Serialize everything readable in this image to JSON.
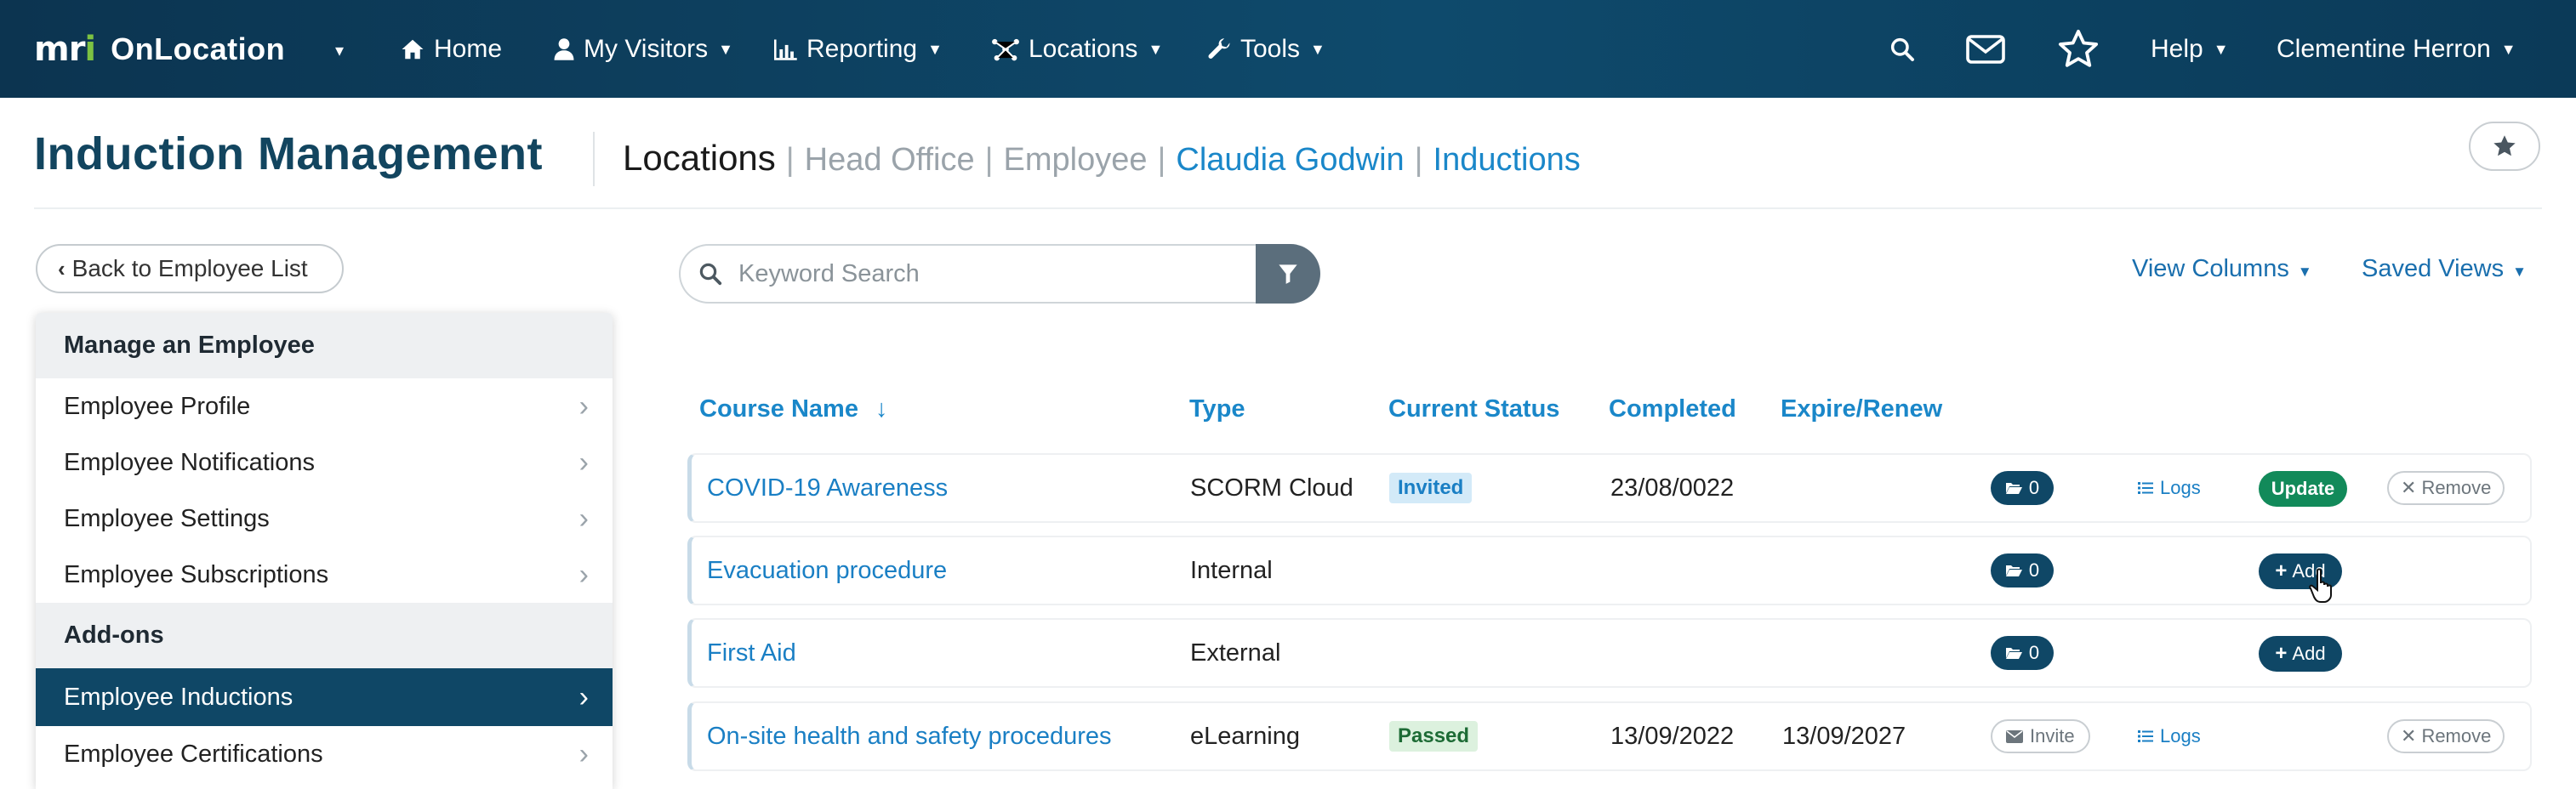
{
  "topnav": {
    "brand": {
      "logo_text": "mri",
      "app_name": "OnLocation"
    },
    "items": [
      {
        "label": "Home",
        "icon": "home-icon"
      },
      {
        "label": "My Visitors",
        "icon": "user-icon"
      },
      {
        "label": "Reporting",
        "icon": "bar-chart-icon"
      },
      {
        "label": "Locations",
        "icon": "network-icon"
      },
      {
        "label": "Tools",
        "icon": "wrench-icon"
      }
    ],
    "right": {
      "help_label": "Help",
      "user_name": "Clementine Herron"
    }
  },
  "header": {
    "title": "Induction Management",
    "breadcrumb": {
      "root": "Locations",
      "items": [
        "Head Office",
        "Employee",
        "Claudia Godwin",
        "Inductions"
      ]
    }
  },
  "sidebar": {
    "back_label": "Back to Employee List",
    "manage_heading": "Manage an Employee",
    "manage_items": [
      "Employee Profile",
      "Employee Notifications",
      "Employee Settings",
      "Employee Subscriptions"
    ],
    "addons_heading": "Add-ons",
    "addon_items": [
      "Employee Inductions",
      "Employee Certifications"
    ],
    "active_item": "Employee Inductions"
  },
  "toolbar": {
    "search_placeholder": "Keyword Search",
    "view_columns_label": "View Columns",
    "saved_views_label": "Saved Views"
  },
  "table": {
    "columns": [
      "Course Name",
      "Type",
      "Current Status",
      "Completed",
      "Expire/Renew"
    ],
    "sort_indicator": "↓",
    "rows": [
      {
        "name": "COVID-19 Awareness",
        "type": "SCORM Cloud",
        "status": "Invited",
        "completed": "23/08/0022",
        "expire": "",
        "files": "0",
        "invite": "",
        "logs": "Logs",
        "action": "Update",
        "remove": "Remove"
      },
      {
        "name": "Evacuation procedure",
        "type": "Internal",
        "status": "",
        "completed": "",
        "expire": "",
        "files": "0",
        "invite": "",
        "logs": "",
        "action": "Add",
        "remove": ""
      },
      {
        "name": "First Aid",
        "type": "External",
        "status": "",
        "completed": "",
        "expire": "",
        "files": "0",
        "invite": "",
        "logs": "",
        "action": "Add",
        "remove": ""
      },
      {
        "name": "On-site health and safety procedures",
        "type": "eLearning",
        "status": "Passed",
        "completed": "13/09/2022",
        "expire": "13/09/2027",
        "files": "",
        "invite": "Invite",
        "logs": "Logs",
        "action": "",
        "remove": "Remove"
      }
    ]
  },
  "colors": {
    "nav_bg": "#0e4a6c",
    "accent_link": "#1a87c9",
    "active_sidebar": "#0f4766",
    "update_green": "#128a5a",
    "logo_green": "#7cc242"
  }
}
